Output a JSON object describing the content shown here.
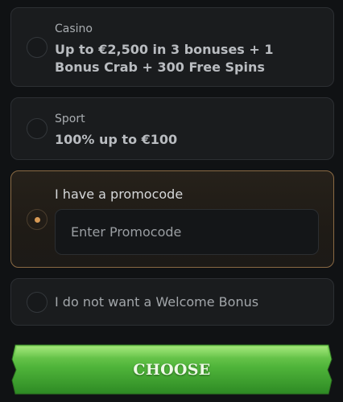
{
  "options": [
    {
      "title": "Casino",
      "description": "Up to €2,500 in 3 bonuses + 1 Bonus Crab + 300 Free Spins",
      "selected": false
    },
    {
      "title": "Sport",
      "description": "100% up to €100",
      "selected": false
    },
    {
      "title": "I have a promocode",
      "selected": true,
      "input_placeholder": "Enter Promocode"
    },
    {
      "title": "I do not want a Welcome Bonus",
      "selected": false
    }
  ],
  "cta": {
    "label": "CHOOSE"
  },
  "colors": {
    "accent": "#d89a55",
    "selected_border": "#8a6a44",
    "button_green": "#4caf3c"
  }
}
